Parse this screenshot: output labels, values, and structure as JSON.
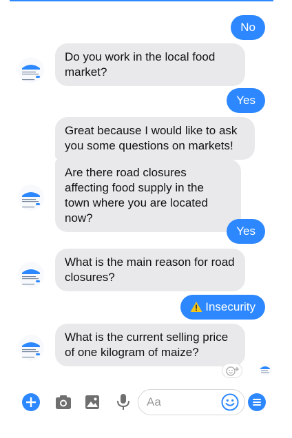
{
  "colors": {
    "accent": "#2d88ff",
    "incoming_bubble": "#e9e9eb",
    "outgoing_bubble": "#2d88ff",
    "warning_icon": "#f5c518",
    "toolbar_icon": "#6f6f6f"
  },
  "messages": [
    {
      "sender": "user",
      "text": "No"
    },
    {
      "sender": "bot",
      "text": "Do you  work in the local food market?"
    },
    {
      "sender": "user",
      "text": "Yes"
    },
    {
      "sender": "bot",
      "text": "Great because I would like to ask you some questions on markets!"
    },
    {
      "sender": "bot",
      "text": "Are there road closures affecting food supply in the town where you are located now?"
    },
    {
      "sender": "user",
      "text": "Yes"
    },
    {
      "sender": "bot",
      "text": "What is the main reason for road closures?"
    },
    {
      "sender": "user",
      "text": "Insecurity",
      "icon": "warning-icon"
    },
    {
      "sender": "bot",
      "text": "What is the current selling price of one kilogram of maize?"
    }
  ],
  "composer": {
    "placeholder": "Aa",
    "icons": [
      "plus-icon",
      "camera-icon",
      "image-icon",
      "microphone-icon",
      "emoji-icon",
      "menu-icon"
    ]
  }
}
